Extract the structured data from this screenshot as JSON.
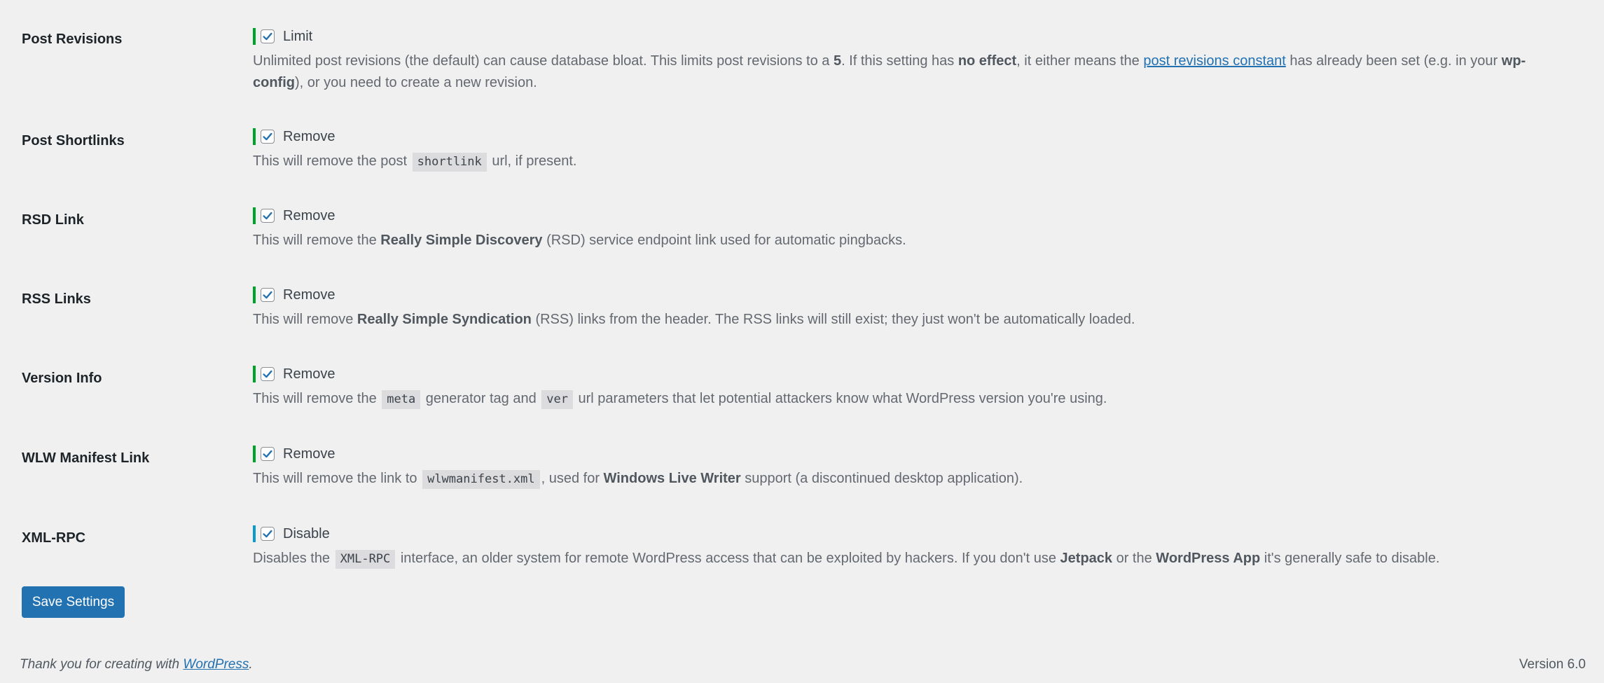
{
  "settings": [
    {
      "label": "Post Revisions",
      "checkbox_label": "Limit",
      "checked": true,
      "status_color": "#00a32a",
      "description": [
        {
          "t": "Unlimited post revisions (the default) can cause database bloat. This limits post revisions to a "
        },
        {
          "b": "5"
        },
        {
          "t": ". If this setting has "
        },
        {
          "b": "no effect"
        },
        {
          "t": ", it either means the "
        },
        {
          "a": "post revisions constant"
        },
        {
          "t": " has already been set (e.g. in your "
        },
        {
          "b": "wp-config"
        },
        {
          "t": "), or you need to create a new revision."
        }
      ]
    },
    {
      "label": "Post Shortlinks",
      "checkbox_label": "Remove",
      "checked": true,
      "status_color": "#00a32a",
      "description": [
        {
          "t": "This will remove the post "
        },
        {
          "c": "shortlink"
        },
        {
          "t": " url, if present."
        }
      ]
    },
    {
      "label": "RSD Link",
      "checkbox_label": "Remove",
      "checked": true,
      "status_color": "#00a32a",
      "description": [
        {
          "t": "This will remove the "
        },
        {
          "b": "Really Simple Discovery"
        },
        {
          "t": " (RSD) service endpoint link used for automatic pingbacks."
        }
      ]
    },
    {
      "label": "RSS Links",
      "checkbox_label": "Remove",
      "checked": true,
      "status_color": "#00a32a",
      "description": [
        {
          "t": "This will remove "
        },
        {
          "b": "Really Simple Syndication"
        },
        {
          "t": " (RSS) links from the header. The RSS links will still exist; they just won't be automatically loaded."
        }
      ]
    },
    {
      "label": "Version Info",
      "checkbox_label": "Remove",
      "checked": true,
      "status_color": "#00a32a",
      "description": [
        {
          "t": "This will remove the "
        },
        {
          "c": "meta"
        },
        {
          "t": " generator tag and "
        },
        {
          "c": "ver"
        },
        {
          "t": " url parameters that let potential attackers know what WordPress version you're using."
        }
      ]
    },
    {
      "label": "WLW Manifest Link",
      "checkbox_label": "Remove",
      "checked": true,
      "status_color": "#00a32a",
      "description": [
        {
          "t": "This will remove the link to "
        },
        {
          "c": "wlwmanifest.xml"
        },
        {
          "t": ", used for "
        },
        {
          "b": "Windows Live Writer"
        },
        {
          "t": " support (a discontinued desktop application)."
        }
      ]
    },
    {
      "label": "XML-RPC",
      "checkbox_label": "Disable",
      "checked": true,
      "status_color": "#0a9ad1",
      "description": [
        {
          "t": "Disables the "
        },
        {
          "c": "XML-RPC"
        },
        {
          "t": " interface, an older system for remote WordPress access that can be exploited by hackers. If you don't use "
        },
        {
          "b": "Jetpack"
        },
        {
          "t": " or the "
        },
        {
          "b": "WordPress App"
        },
        {
          "t": " it's generally safe to disable."
        }
      ]
    }
  ],
  "save_button": "Save Settings",
  "footer": {
    "thanks_prefix": "Thank you for creating with ",
    "thanks_link": "WordPress",
    "thanks_suffix": ".",
    "version": "Version 6.0"
  }
}
